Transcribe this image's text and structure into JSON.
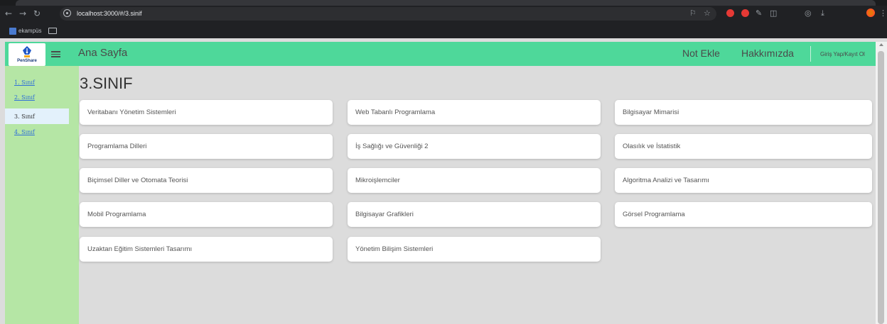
{
  "browser": {
    "url": "localhost:3000/#/3.sinif",
    "bookmark_label": "ekampüs"
  },
  "navbar": {
    "logo_text": "PenShare",
    "title": "Ana Sayfa",
    "links": [
      "Not Ekle",
      "Hakkımızda"
    ],
    "login": "Giriş Yap/Kayıt Ol",
    "color": "#4ed89a"
  },
  "sidebar": {
    "items": [
      "1. Sınıf",
      "2. Sınıf",
      "3. Sınıf",
      "4. Sınıf"
    ],
    "active_index": 2,
    "color": "#b5e6a5"
  },
  "main": {
    "title": "3.SINIF",
    "courses": [
      "Veritabanı Yönetim Sistemleri",
      "Web Tabanlı Programlama",
      "Bilgisayar Mimarisi",
      "Programlama Dilleri",
      "İş Sağlığı ve Güvenliği 2",
      "Olasılık ve İstatistik",
      "Biçimsel Diller ve Otomata Teorisi",
      "Mikroişlemciler",
      "Algoritma Analizi ve Tasarımı",
      "Mobil Programlama",
      "Bilgisayar Grafikleri",
      "Görsel Programlama",
      "Uzaktan Eğitim Sistemleri Tasarımı",
      "Yönetim Bilişim Sistemleri"
    ]
  }
}
